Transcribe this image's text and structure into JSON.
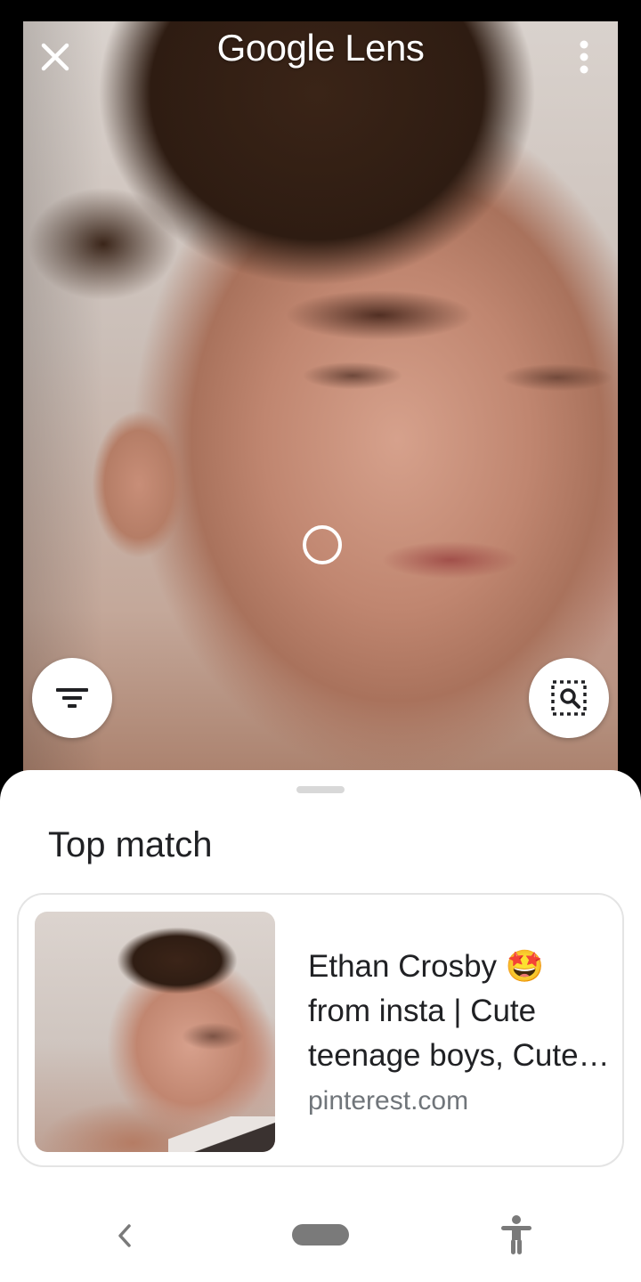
{
  "header": {
    "title": "Google Lens",
    "close_icon": "close-icon",
    "more_icon": "more-vert-icon"
  },
  "camera": {
    "focus_icon": "focus-ring-icon",
    "filter_button_icon": "filter-icon",
    "search_region_button_icon": "search-region-icon"
  },
  "sheet": {
    "section_title": "Top match",
    "top_match": {
      "title": "Ethan Crosby 🤩 from insta | Cute teenage boys, Cute boys, Boys",
      "source": "pinterest.com"
    }
  },
  "navbar": {
    "back_icon": "back-chevron-icon",
    "home_icon": "home-pill-icon",
    "accessibility_icon": "accessibility-icon"
  },
  "colors": {
    "sheet_background": "#ffffff",
    "title_text": "#202124",
    "source_text": "#70757a",
    "icon_dark": "#202124"
  }
}
